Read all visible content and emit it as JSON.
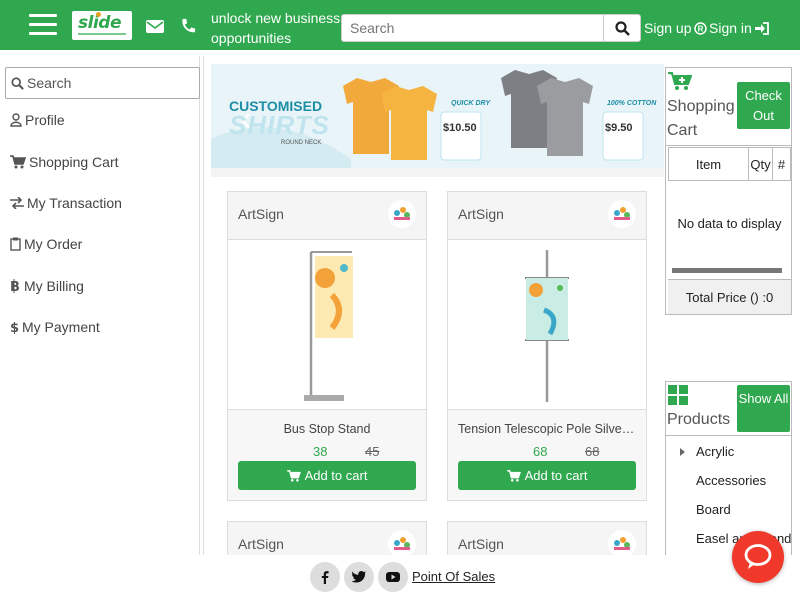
{
  "header": {
    "tagline": "unlock new business opportunities",
    "search_placeholder": "Search",
    "signup_label": "Sign up",
    "signin_label": "Sign in",
    "brand_color": "#2fa84f"
  },
  "sidebar": {
    "search_placeholder": "Search",
    "items": [
      {
        "label": "Profile",
        "icon": "user-icon"
      },
      {
        "label": "Shopping Cart",
        "icon": "cart-icon"
      },
      {
        "label": "My Transaction",
        "icon": "exchange-icon"
      },
      {
        "label": "My Order",
        "icon": "clipboard-icon"
      },
      {
        "label": "My Billing",
        "icon": "bitcoin-icon"
      },
      {
        "label": "My Payment",
        "icon": "dollar-icon"
      }
    ]
  },
  "banner": {
    "heading1": "CUSTOMISED",
    "heading2": "SHIRTS",
    "subheading": "ROUND NECK",
    "tag1": "QUICK DRY",
    "tag2": "100% COTTON",
    "price1": "$10.50",
    "price2": "$9.50"
  },
  "products": [
    {
      "brand": "ArtSign",
      "name": "Bus Stop Stand",
      "price": "38",
      "old_price": "45",
      "button": "Add to cart"
    },
    {
      "brand": "ArtSign",
      "name": "Tension Telescopic Pole Silver Stand",
      "price": "68",
      "old_price": "68",
      "button": "Add to cart"
    },
    {
      "brand": "ArtSign"
    },
    {
      "brand": "ArtSign"
    }
  ],
  "cart": {
    "title": "Shopping Cart",
    "checkout_label": "Check Out",
    "columns": [
      "Item",
      "Qty",
      "#"
    ],
    "empty_text": "No data to display",
    "total_text": "Total Price () :0"
  },
  "product_panel": {
    "title": "Products",
    "show_all_label": "Show All",
    "categories": [
      "Acrylic",
      "Accessories",
      "Board",
      "Easel and Stand"
    ]
  },
  "footer": {
    "link_label": "Point Of Sales"
  }
}
